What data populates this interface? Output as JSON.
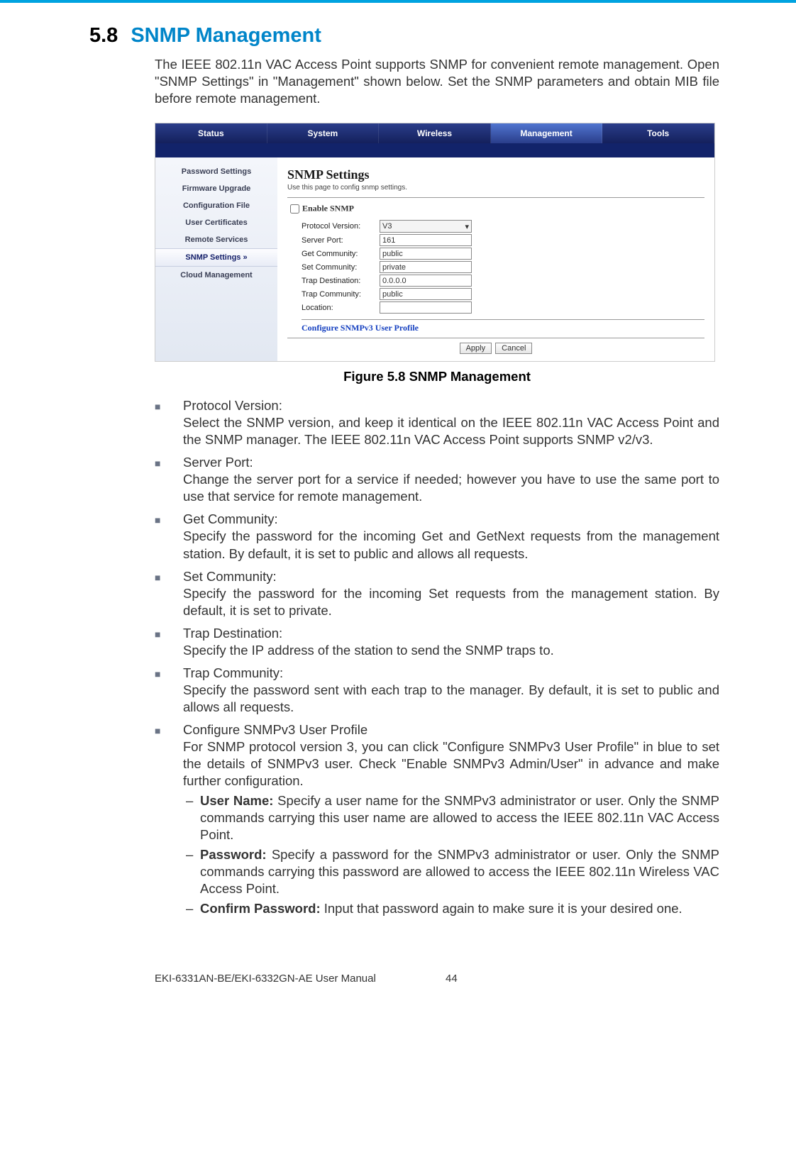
{
  "heading": {
    "num": "5.8",
    "title": "SNMP Management"
  },
  "intro": "The IEEE 802.11n VAC Access Point supports SNMP for convenient remote man­agement. Open \"SNMP Settings\" in \"Management\" shown below. Set the SNMP parameters and obtain MIB file before remote management.",
  "screenshot": {
    "tabs": [
      "Status",
      "System",
      "Wireless",
      "Management",
      "Tools"
    ],
    "active_tab": "Management",
    "sidebar": [
      "Password Settings",
      "Firmware Upgrade",
      "Configuration File",
      "User Certificates",
      "Remote Services",
      "SNMP Settings",
      "Cloud Management"
    ],
    "selected_sidebar": "SNMP Settings",
    "panel_title": "SNMP Settings",
    "panel_sub": "Use this page to config snmp settings.",
    "enable_label": "Enable SNMP",
    "fields": {
      "protocol_version": {
        "label": "Protocol Version:",
        "value": "V3"
      },
      "server_port": {
        "label": "Server Port:",
        "value": "161"
      },
      "get_community": {
        "label": "Get Community:",
        "value": "public"
      },
      "set_community": {
        "label": "Set Community:",
        "value": "private"
      },
      "trap_destination": {
        "label": "Trap Destination:",
        "value": "0.0.0.0"
      },
      "trap_community": {
        "label": "Trap Community:",
        "value": "public"
      },
      "location": {
        "label": "Location:",
        "value": ""
      }
    },
    "link": "Configure SNMPv3 User Profile",
    "buttons": {
      "apply": "Apply",
      "cancel": "Cancel"
    }
  },
  "figure_caption": "Figure 5.8 SNMP Management",
  "items": [
    {
      "title": "Protocol Version:",
      "desc": "Select the SNMP version, and keep it identical on the IEEE 802.11n VAC Access Point and the SNMP manager.  The IEEE 802.11n VAC Access Point supports SNMP v2/v3."
    },
    {
      "title": "Server Port:",
      "desc": "Change the server port for a service if needed; however you have to use the same port to use that service for remote management."
    },
    {
      "title": "Get Community:",
      "desc": "Specify the password for the incoming Get and GetNext requests from the man­agement station. By default, it is set to public and allows all requests."
    },
    {
      "title": "Set Community:",
      "desc": "Specify the password for the incoming Set requests from the management sta­tion. By default, it is set to private."
    },
    {
      "title": "Trap Destination:",
      "desc": "Specify the IP address of the station to send the SNMP traps to."
    },
    {
      "title": "Trap Community:",
      "desc": "Specify the password sent with each trap to the manager. By default, it is set to public and allows all requests."
    },
    {
      "title": "Configure SNMPv3 User Profile",
      "desc": "For SNMP protocol version 3, you can click \"Configure SNMPv3 User Profile\" in blue to set the details of SNMPv3 user. Check \"Enable SNMPv3 Admin/User\" in advance and make further configuration."
    }
  ],
  "subs": [
    {
      "label": "User Name:",
      "text": " Specify a user name for the SNMPv3 administrator or user. Only the SNMP commands carrying this user name are allowed to access the IEEE 802.11n VAC Access Point."
    },
    {
      "label": "Password:",
      "text": " Specify a password for the SNMPv3 administrator or user. Only the SNMP commands carrying this password are allowed to access the IEEE 802.11n Wireless VAC Access Point."
    },
    {
      "label": "Confirm Password:",
      "text": " Input that password again to make sure it is your desired one."
    }
  ],
  "footer": {
    "manual": "EKI-6331AN-BE/EKI-6332GN-AE User Manual",
    "page": "44"
  }
}
